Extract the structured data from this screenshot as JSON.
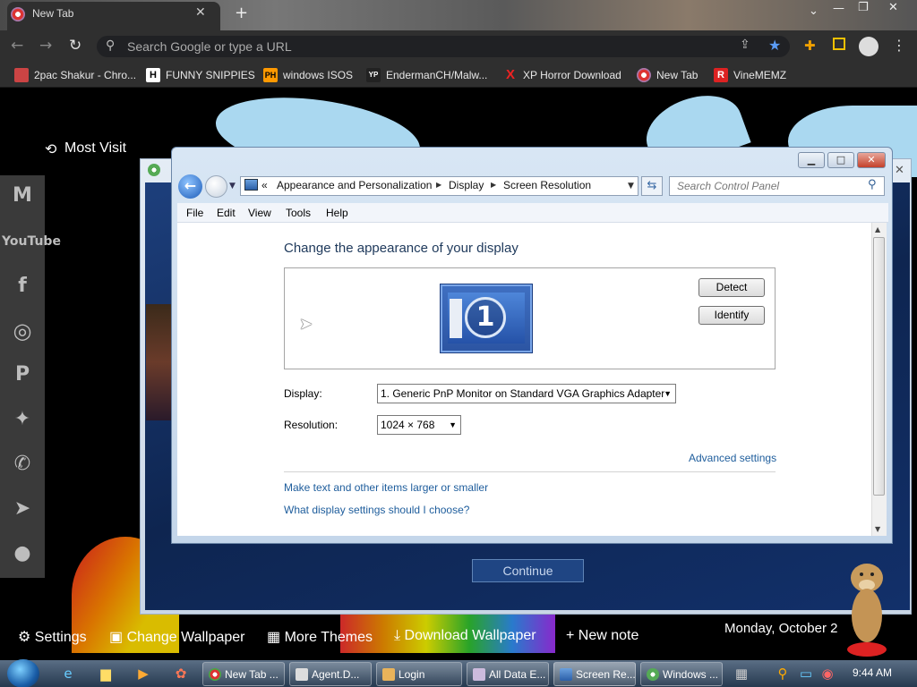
{
  "browser": {
    "tab_title": "New Tab",
    "omnibox_placeholder": "Search Google or type a URL",
    "bookmarks": [
      {
        "label": "2pac Shakur - Chro...",
        "icon": "bookmark-icon"
      },
      {
        "label": "FUNNY SNIPPIES",
        "icon": "H"
      },
      {
        "label": "windows ISOS",
        "icon": "PH"
      },
      {
        "label": "EndermanCH/Malw...",
        "icon": "YP"
      },
      {
        "label": "XP Horror Download",
        "icon": "X"
      },
      {
        "label": "New Tab",
        "icon": "chrome-icon"
      },
      {
        "label": "VineMEMZ",
        "icon": "R"
      }
    ]
  },
  "newtab": {
    "most_visited": "Most Visit",
    "settings": "Settings",
    "change_wallpaper": "Change Wallpaper",
    "more_themes": "More Themes",
    "download_wallpaper": "Download Wallpaper",
    "new_note": "+ New note",
    "date": "Monday, October 2"
  },
  "installer": {
    "continue_label": "Continue"
  },
  "control_panel": {
    "breadcrumbs": [
      "«",
      "Appearance and Personalization",
      "Display",
      "Screen Resolution"
    ],
    "search_placeholder": "Search Control Panel",
    "menu": [
      "File",
      "Edit",
      "View",
      "Tools",
      "Help"
    ],
    "heading": "Change the appearance of your display",
    "monitor_number": "1",
    "detect_label": "Detect",
    "identify_label": "Identify",
    "display_label": "Display:",
    "display_value": "1. Generic PnP Monitor on Standard VGA Graphics Adapter",
    "resolution_label": "Resolution:",
    "resolution_value": "1024 × 768",
    "advanced_settings": "Advanced settings",
    "link_text_size": "Make text and other items larger or smaller",
    "link_help": "What display settings should I choose?"
  },
  "taskbar": {
    "items": [
      "New Tab ...",
      "Agent.D...",
      "Login",
      "All Data E...",
      "Screen Re...",
      "Windows ..."
    ],
    "clock": "9:44 AM"
  }
}
